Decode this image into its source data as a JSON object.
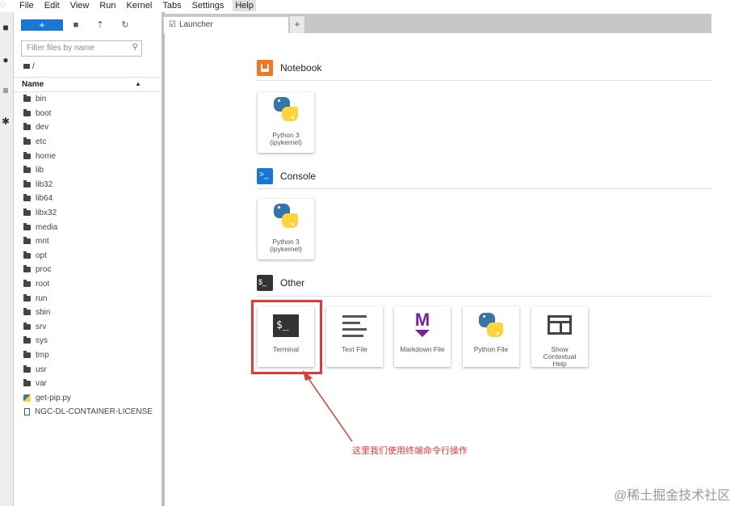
{
  "menu": {
    "items": [
      "File",
      "Edit",
      "View",
      "Run",
      "Kernel",
      "Tabs",
      "Settings",
      "Help"
    ],
    "active": "Help"
  },
  "filebrowser": {
    "new_button": "+",
    "filter_placeholder": "Filter files by name",
    "breadcrumb": "/",
    "column_name": "Name",
    "files": [
      {
        "name": "bin",
        "type": "folder"
      },
      {
        "name": "boot",
        "type": "folder"
      },
      {
        "name": "dev",
        "type": "folder"
      },
      {
        "name": "etc",
        "type": "folder"
      },
      {
        "name": "home",
        "type": "folder"
      },
      {
        "name": "lib",
        "type": "folder"
      },
      {
        "name": "lib32",
        "type": "folder"
      },
      {
        "name": "lib64",
        "type": "folder"
      },
      {
        "name": "libx32",
        "type": "folder"
      },
      {
        "name": "media",
        "type": "folder"
      },
      {
        "name": "mnt",
        "type": "folder"
      },
      {
        "name": "opt",
        "type": "folder"
      },
      {
        "name": "proc",
        "type": "folder"
      },
      {
        "name": "root",
        "type": "folder"
      },
      {
        "name": "run",
        "type": "folder"
      },
      {
        "name": "sbin",
        "type": "folder"
      },
      {
        "name": "srv",
        "type": "folder"
      },
      {
        "name": "sys",
        "type": "folder"
      },
      {
        "name": "tmp",
        "type": "folder"
      },
      {
        "name": "usr",
        "type": "folder"
      },
      {
        "name": "var",
        "type": "folder"
      },
      {
        "name": "get-pip.py",
        "type": "python"
      },
      {
        "name": "NGC-DL-CONTAINER-LICENSE",
        "type": "file"
      }
    ]
  },
  "tab": {
    "label": "Launcher",
    "plus": "+"
  },
  "launcher": {
    "notebook": {
      "title": "Notebook",
      "card_label_1": "Python 3",
      "card_label_2": "(ipykernel)"
    },
    "console": {
      "title": "Console",
      "card_label_1": "Python 3",
      "card_label_2": "(ipykernel)"
    },
    "other": {
      "title": "Other",
      "terminal": "Terminal",
      "text_file": "Text File",
      "markdown_file": "Markdown File",
      "python_file": "Python File",
      "help_1": "Show",
      "help_2": "Contextual",
      "help_3": "Help"
    }
  },
  "annotation": "这里我们使用终端命令行操作",
  "watermark": "@稀土掘金技术社区",
  "colors": {
    "accent": "#1976d2",
    "annotation": "#e53935",
    "notebook_icon": "#f37626",
    "console_icon": "#1976d2"
  }
}
